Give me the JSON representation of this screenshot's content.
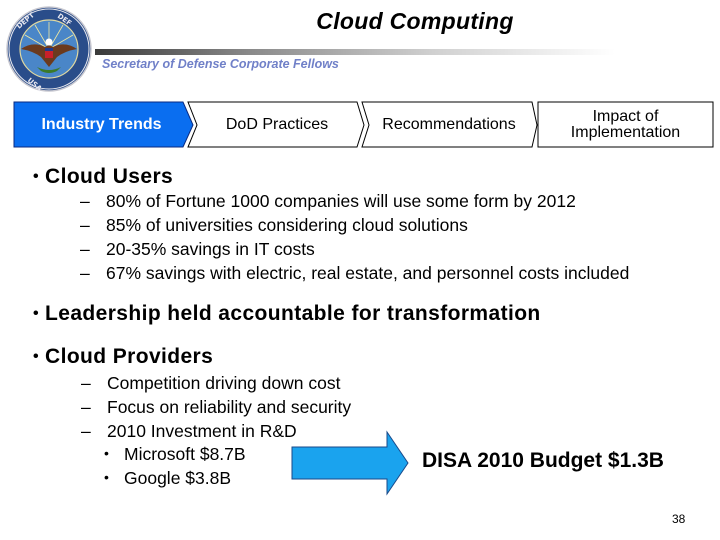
{
  "header": {
    "title": "Cloud Computing",
    "subtitle": "Secretary of Defense Corporate Fellows",
    "logo": "dod-seal-icon"
  },
  "process_steps": [
    {
      "label": "Industry Trends",
      "active": true
    },
    {
      "label": "DoD Practices",
      "active": false
    },
    {
      "label": "Recommendations",
      "active": false
    },
    {
      "label_line1": "Impact of",
      "label_line2": "Implementation",
      "active": false
    }
  ],
  "colors": {
    "active_step": "#0a6ef0",
    "arrow": "#1aa3ee",
    "subtitle": "#7080c8"
  },
  "content": {
    "cloud_users": {
      "heading": "Cloud Users",
      "items": [
        "80% of Fortune 1000 companies will use some form by 2012",
        "85% of universities considering cloud solutions",
        "20-35% savings in IT costs",
        "67% savings with electric, real estate, and personnel costs included"
      ]
    },
    "leadership": {
      "heading": "Leadership held accountable for transformation"
    },
    "cloud_providers": {
      "heading": "Cloud Providers",
      "items": [
        "Competition driving down cost",
        "Focus on reliability and security",
        "2010 Investment in R&D"
      ],
      "investments": [
        "Microsoft $8.7B",
        "Google $3.8B"
      ]
    },
    "budget_callout": "DISA 2010 Budget $1.3B"
  },
  "bullet_glyph": "•",
  "dash_glyph": "–",
  "page_number": "38"
}
